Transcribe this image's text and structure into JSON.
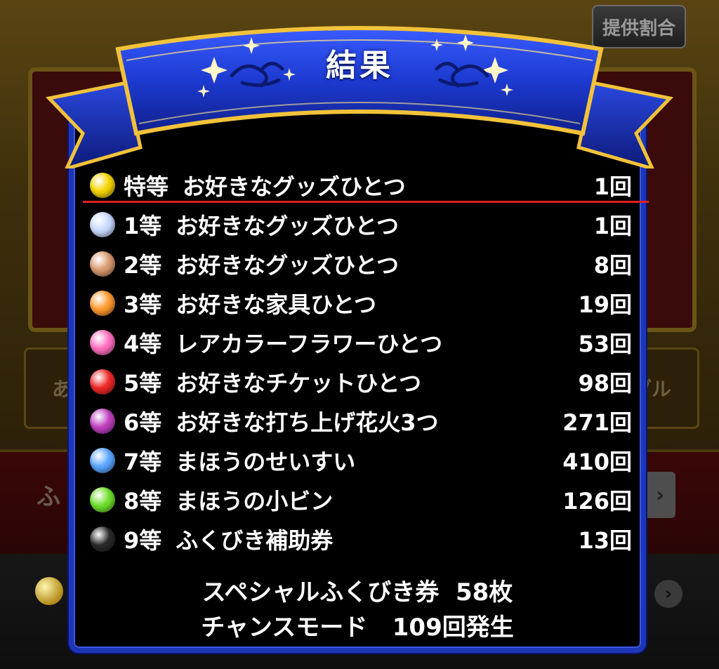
{
  "header": {
    "provide_button_label": "提供割合"
  },
  "background": {
    "left_button_text": "あら",
    "right_button_text": "ブル",
    "band_text": "ふ"
  },
  "dialog": {
    "title": "結果",
    "results": [
      {
        "rank": "特等",
        "prize": "お好きなグッズひとつ",
        "count": "1回",
        "gem_color": "#f5d400",
        "gem_icon": "gold-orb-icon"
      },
      {
        "rank": "1等",
        "prize": "お好きなグッズひとつ",
        "count": "1回",
        "gem_color": "#c8d8ff",
        "gem_icon": "silver-orb-icon"
      },
      {
        "rank": "2等",
        "prize": "お好きなグッズひとつ",
        "count": "8回",
        "gem_color": "#d99a70",
        "gem_icon": "bronze-orb-icon"
      },
      {
        "rank": "3等",
        "prize": "お好きな家具ひとつ",
        "count": "19回",
        "gem_color": "#ff9a2e",
        "gem_icon": "orange-orb-icon"
      },
      {
        "rank": "4等",
        "prize": "レアカラーフラワーひとつ",
        "count": "53回",
        "gem_color": "#ff6ec0",
        "gem_icon": "pink-orb-icon"
      },
      {
        "rank": "5等",
        "prize": "お好きなチケットひとつ",
        "count": "98回",
        "gem_color": "#f02828",
        "gem_icon": "red-orb-icon"
      },
      {
        "rank": "6等",
        "prize": "お好きな打ち上げ花火3つ",
        "count": "271回",
        "gem_color": "#c040c0",
        "gem_icon": "purple-orb-icon"
      },
      {
        "rank": "7等",
        "prize": "まほうのせいすい",
        "count": "410回",
        "gem_color": "#5aa6ff",
        "gem_icon": "blue-orb-icon"
      },
      {
        "rank": "8等",
        "prize": "まほうの小ビン",
        "count": "126回",
        "gem_color": "#6ee02a",
        "gem_icon": "green-orb-icon"
      },
      {
        "rank": "9等",
        "prize": "ふくびき補助券",
        "count": "13回",
        "gem_color": "#2a2a2a",
        "gem_icon": "black-orb-icon"
      }
    ],
    "footer": {
      "special_tickets": "スペシャルふくびき券  58枚",
      "chance_mode": "チャンスモード   109回発生"
    }
  },
  "colors": {
    "ribbon_blue": "#1c3ad0",
    "ribbon_gold": "#f2c23a",
    "panel_border": "#1d36b8",
    "divider_red": "#e02020"
  }
}
